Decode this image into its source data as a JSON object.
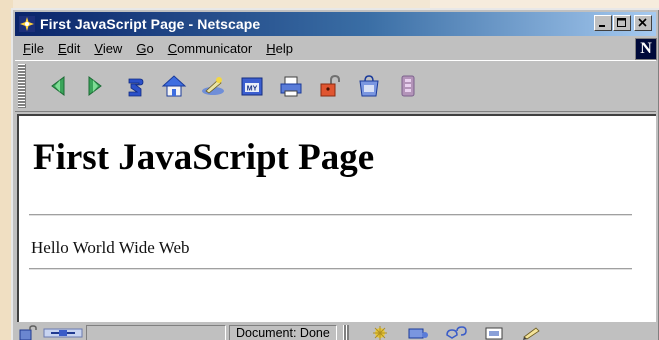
{
  "window": {
    "title": "First JavaScript Page - Netscape"
  },
  "menu": {
    "items": [
      {
        "label": "File",
        "accel": "F"
      },
      {
        "label": "Edit",
        "accel": "E"
      },
      {
        "label": "View",
        "accel": "V"
      },
      {
        "label": "Go",
        "accel": "G"
      },
      {
        "label": "Communicator",
        "accel": "C"
      },
      {
        "label": "Help",
        "accel": "H"
      }
    ]
  },
  "toolbar": {
    "buttons": [
      {
        "name": "back",
        "icon": "back-arrow-icon"
      },
      {
        "name": "forward",
        "icon": "forward-arrow-icon"
      },
      {
        "name": "reload",
        "icon": "reload-icon"
      },
      {
        "name": "home",
        "icon": "home-icon"
      },
      {
        "name": "search",
        "icon": "search-icon"
      },
      {
        "name": "netscape",
        "icon": "my-netscape-icon"
      },
      {
        "name": "print",
        "icon": "print-icon"
      },
      {
        "name": "security",
        "icon": "security-lock-icon"
      },
      {
        "name": "shop",
        "icon": "shop-icon"
      },
      {
        "name": "stop",
        "icon": "stop-icon"
      }
    ],
    "logo_letter": "N"
  },
  "content": {
    "heading": "First JavaScript Page",
    "text": "Hello World Wide Web"
  },
  "status": {
    "text": "Document: Done"
  },
  "colors": {
    "titlebar_start": "#0a246a",
    "titlebar_end": "#a6caf0",
    "chrome": "#c0c0c0",
    "content_bg": "#ffffff"
  }
}
